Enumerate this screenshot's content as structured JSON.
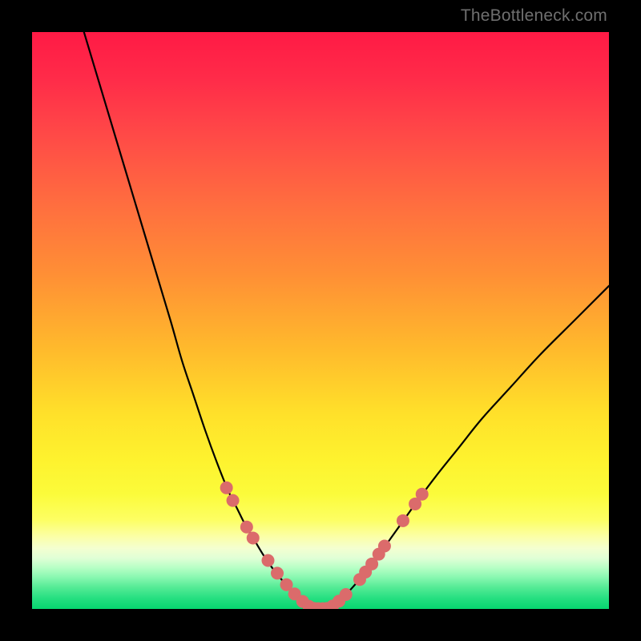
{
  "watermark": "TheBottleneck.com",
  "colors": {
    "frame": "#000000",
    "curve": "#000000",
    "dot_fill": "#db6b6b",
    "dot_stroke": "#b04f4f"
  },
  "gradient_stops": [
    {
      "offset": 0.0,
      "color": "#ff1a45"
    },
    {
      "offset": 0.08,
      "color": "#ff2b49"
    },
    {
      "offset": 0.18,
      "color": "#ff4a47"
    },
    {
      "offset": 0.3,
      "color": "#ff6e3f"
    },
    {
      "offset": 0.42,
      "color": "#ff8f35"
    },
    {
      "offset": 0.55,
      "color": "#ffba2c"
    },
    {
      "offset": 0.66,
      "color": "#ffe02a"
    },
    {
      "offset": 0.74,
      "color": "#fef22e"
    },
    {
      "offset": 0.8,
      "color": "#fbfb3a"
    },
    {
      "offset": 0.845,
      "color": "#fdff62"
    },
    {
      "offset": 0.875,
      "color": "#fbffa8"
    },
    {
      "offset": 0.895,
      "color": "#f4ffd0"
    },
    {
      "offset": 0.912,
      "color": "#e0ffd6"
    },
    {
      "offset": 0.928,
      "color": "#b8ffc6"
    },
    {
      "offset": 0.944,
      "color": "#8cf8b2"
    },
    {
      "offset": 0.962,
      "color": "#56eb96"
    },
    {
      "offset": 0.982,
      "color": "#24df80"
    },
    {
      "offset": 1.0,
      "color": "#06d66f"
    }
  ],
  "chart_data": {
    "type": "line",
    "title": "",
    "xlabel": "",
    "ylabel": "",
    "xlim": [
      0,
      100
    ],
    "ylim": [
      0,
      100
    ],
    "series": [
      {
        "name": "left-curve",
        "x": [
          9,
          12,
          15,
          18,
          21,
          24,
          26,
          28,
          30,
          32,
          34,
          35.5,
          37,
          38.5,
          40,
          41.5,
          43,
          44.3,
          45.4,
          46.3,
          47.1,
          47.8,
          48.4,
          48.9
        ],
        "y": [
          100,
          90,
          80,
          70,
          60,
          50,
          43,
          37,
          31,
          25.5,
          20.5,
          17.5,
          14.5,
          12,
          9.5,
          7.3,
          5.4,
          3.9,
          2.7,
          1.8,
          1.1,
          0.6,
          0.25,
          0.05
        ]
      },
      {
        "name": "right-curve",
        "x": [
          51.1,
          51.6,
          52.2,
          52.9,
          53.7,
          54.6,
          55.7,
          57,
          58.5,
          60,
          62,
          64,
          67,
          70,
          74,
          78,
          83,
          88,
          94,
          100
        ],
        "y": [
          0.05,
          0.25,
          0.6,
          1.1,
          1.8,
          2.7,
          3.9,
          5.4,
          7.3,
          9.3,
          12,
          14.8,
          19,
          23,
          28,
          33,
          38.5,
          44,
          50,
          56
        ]
      }
    ],
    "flat_segment": {
      "x": [
        48.9,
        51.1
      ],
      "y": 0.05
    },
    "dots_left": [
      {
        "x": 33.7,
        "y": 21.0
      },
      {
        "x": 34.8,
        "y": 18.8
      },
      {
        "x": 37.2,
        "y": 14.2
      },
      {
        "x": 38.3,
        "y": 12.3
      },
      {
        "x": 40.9,
        "y": 8.4
      },
      {
        "x": 42.5,
        "y": 6.2
      },
      {
        "x": 44.1,
        "y": 4.2
      },
      {
        "x": 45.5,
        "y": 2.6
      },
      {
        "x": 46.9,
        "y": 1.3
      },
      {
        "x": 48.0,
        "y": 0.45
      },
      {
        "x": 48.9,
        "y": 0.08
      }
    ],
    "dots_right": [
      {
        "x": 51.1,
        "y": 0.08
      },
      {
        "x": 52.1,
        "y": 0.5
      },
      {
        "x": 53.2,
        "y": 1.35
      },
      {
        "x": 54.4,
        "y": 2.5
      },
      {
        "x": 56.8,
        "y": 5.1
      },
      {
        "x": 57.8,
        "y": 6.4
      },
      {
        "x": 58.9,
        "y": 7.8
      },
      {
        "x": 60.1,
        "y": 9.5
      },
      {
        "x": 61.1,
        "y": 10.9
      },
      {
        "x": 64.3,
        "y": 15.3
      },
      {
        "x": 66.4,
        "y": 18.2
      },
      {
        "x": 67.6,
        "y": 19.9
      }
    ],
    "dots_flat": [
      {
        "x": 49.6,
        "y": 0.05
      },
      {
        "x": 50.4,
        "y": 0.05
      }
    ],
    "dot_radius_px": 8
  }
}
